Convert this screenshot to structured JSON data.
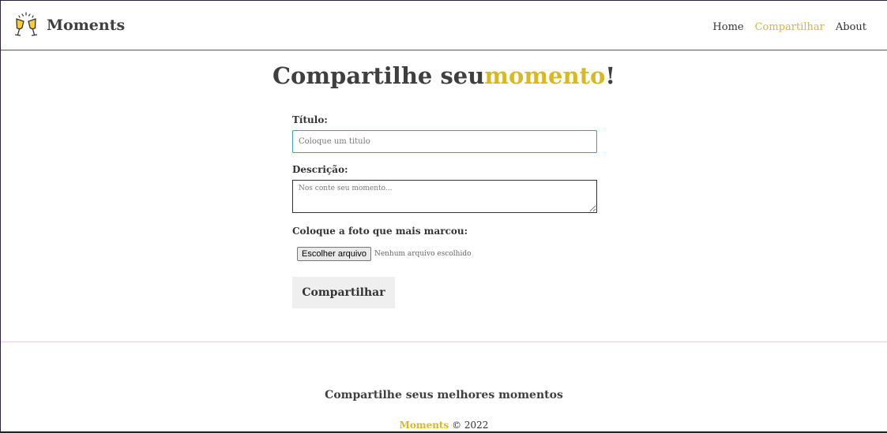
{
  "navbar": {
    "brand_name": "Moments",
    "brand_icon": "champagne-toast-icon",
    "links": [
      {
        "label": "Home",
        "active": false
      },
      {
        "label": "Compartilhar",
        "active": true
      },
      {
        "label": "About",
        "active": false
      }
    ]
  },
  "main": {
    "title_prefix": "Compartilhe seu",
    "title_accent": "momento",
    "title_suffix": "!",
    "form": {
      "title_label": "Título:",
      "title_placeholder": "Coloque um titulo",
      "description_label": "Descrição:",
      "description_placeholder": "Nos conte seu momento...",
      "photo_label": "Coloque a foto que mais marcou:",
      "file_button_label": "Escolher arquivo",
      "file_status": "Nenhum arquivo escolhido",
      "submit_label": "Compartilhar"
    }
  },
  "footer": {
    "tagline": "Compartilhe seus melhores momentos",
    "brand": "Moments",
    "copyright": "© 2022"
  },
  "colors": {
    "accent": "#d8b923",
    "text": "#3f3f3f",
    "input_focus_border": "#2aa5c8",
    "button_bg": "#efefef"
  }
}
